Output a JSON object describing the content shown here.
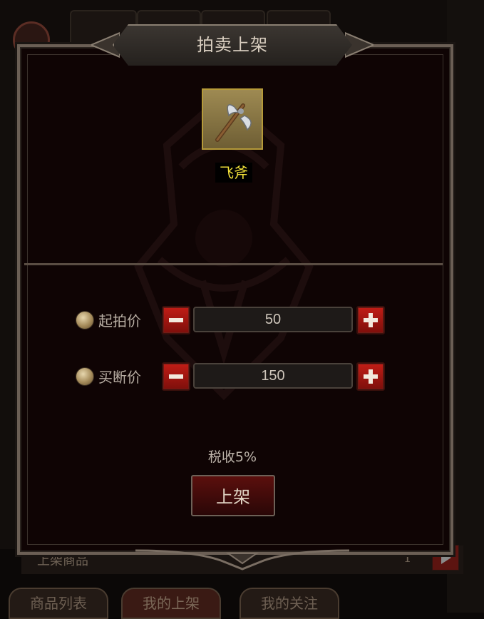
{
  "background": {
    "bottom_row_text": "上架商品",
    "bottom_row_count": "1",
    "tabs": [
      {
        "label": "商品列表"
      },
      {
        "label": "我的上架"
      },
      {
        "label": "我的关注"
      }
    ]
  },
  "dialog": {
    "title": "拍卖上架",
    "item": {
      "name": "飞斧",
      "icon": "axe-icon"
    },
    "start_price": {
      "label": "起拍价",
      "value": "50"
    },
    "buyout_price": {
      "label": "买断价",
      "value": "150"
    },
    "tax_text": "税收5%",
    "list_button": "上架"
  },
  "colors": {
    "accent_red": "#a5170f",
    "item_name_yellow": "#f3e23a",
    "frame": "#6b5f55"
  }
}
